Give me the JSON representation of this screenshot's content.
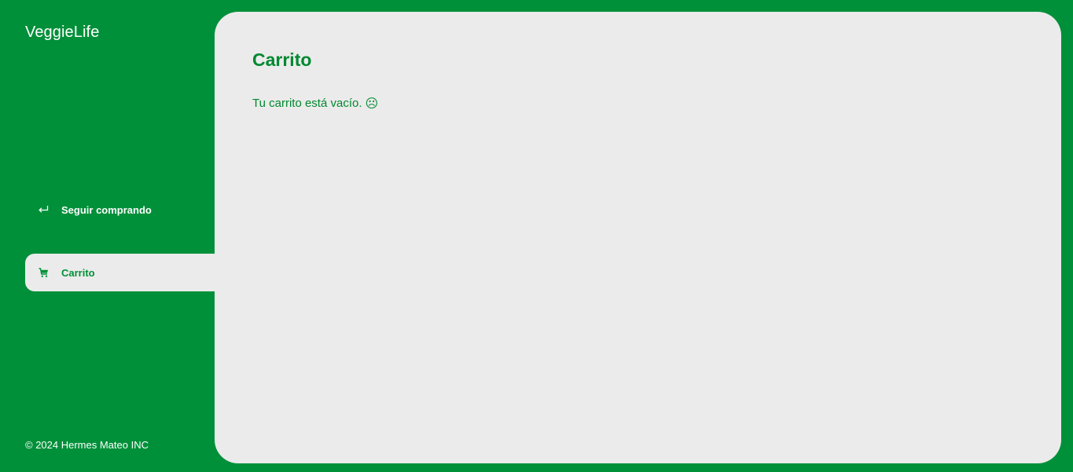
{
  "brand": "VeggieLife",
  "nav": {
    "continue_shopping": {
      "label": "Seguir comprando",
      "icon": "return-arrow-icon"
    },
    "cart": {
      "label": "Carrito",
      "icon": "cart-icon",
      "active": true
    }
  },
  "footer": {
    "copyright": "© 2024 Hermes Mateo INC"
  },
  "main": {
    "title": "Carrito",
    "empty_message": "Tu carrito está vacío.",
    "empty_emoji": "☹"
  },
  "colors": {
    "brand_green": "#009039",
    "text_green": "#00882f",
    "panel_bg": "#ebebeb",
    "white": "#ffffff"
  }
}
